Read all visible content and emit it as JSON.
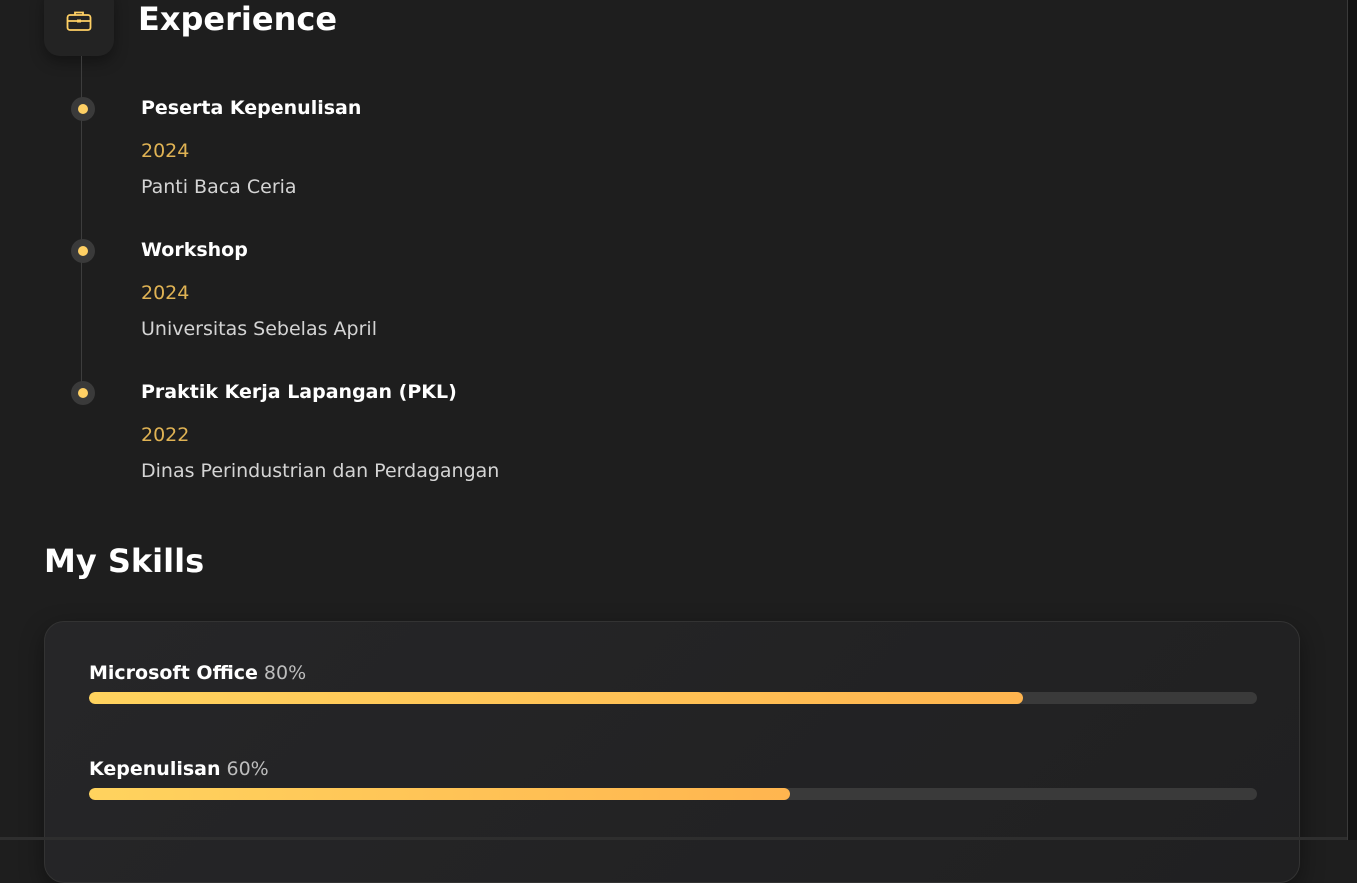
{
  "experience": {
    "title": "Experience",
    "icon": "briefcase-icon",
    "items": [
      {
        "title": "Peserta Kepenulisan",
        "year": "2024",
        "place": "Panti Baca Ceria"
      },
      {
        "title": "Workshop",
        "year": "2024",
        "place": "Universitas Sebelas April"
      },
      {
        "title": "Praktik Kerja Lapangan (PKL)",
        "year": "2022",
        "place": "Dinas Perindustrian dan Perdagangan"
      }
    ]
  },
  "skills": {
    "title": "My Skills",
    "items": [
      {
        "name": "Microsoft Office",
        "percent_label": "80%",
        "percent": 80
      },
      {
        "name": "Kepenulisan",
        "percent_label": "60%",
        "percent": 60
      }
    ]
  },
  "colors": {
    "accent": "#ffd064",
    "year": "#e0b354",
    "background": "#1e1e1e"
  }
}
